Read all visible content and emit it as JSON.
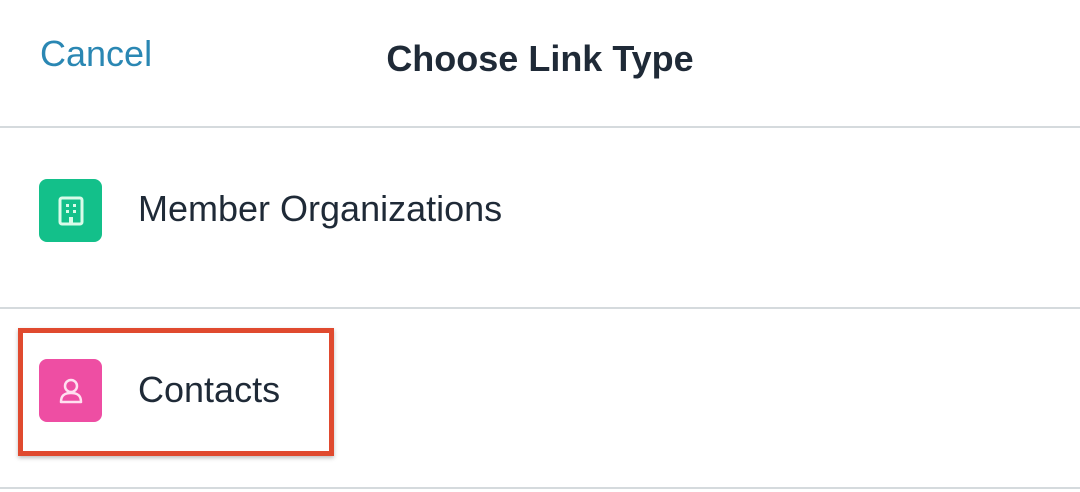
{
  "header": {
    "cancel_label": "Cancel",
    "title": "Choose Link Type"
  },
  "options": [
    {
      "label": "Member Organizations",
      "icon": "building-icon",
      "color": "#13c08a"
    },
    {
      "label": "Contacts",
      "icon": "contact-icon",
      "color": "#ee4ea3"
    }
  ],
  "colors": {
    "accent": "#2a87b3",
    "highlight": "#e04a2f",
    "divider": "#d5dadd"
  }
}
